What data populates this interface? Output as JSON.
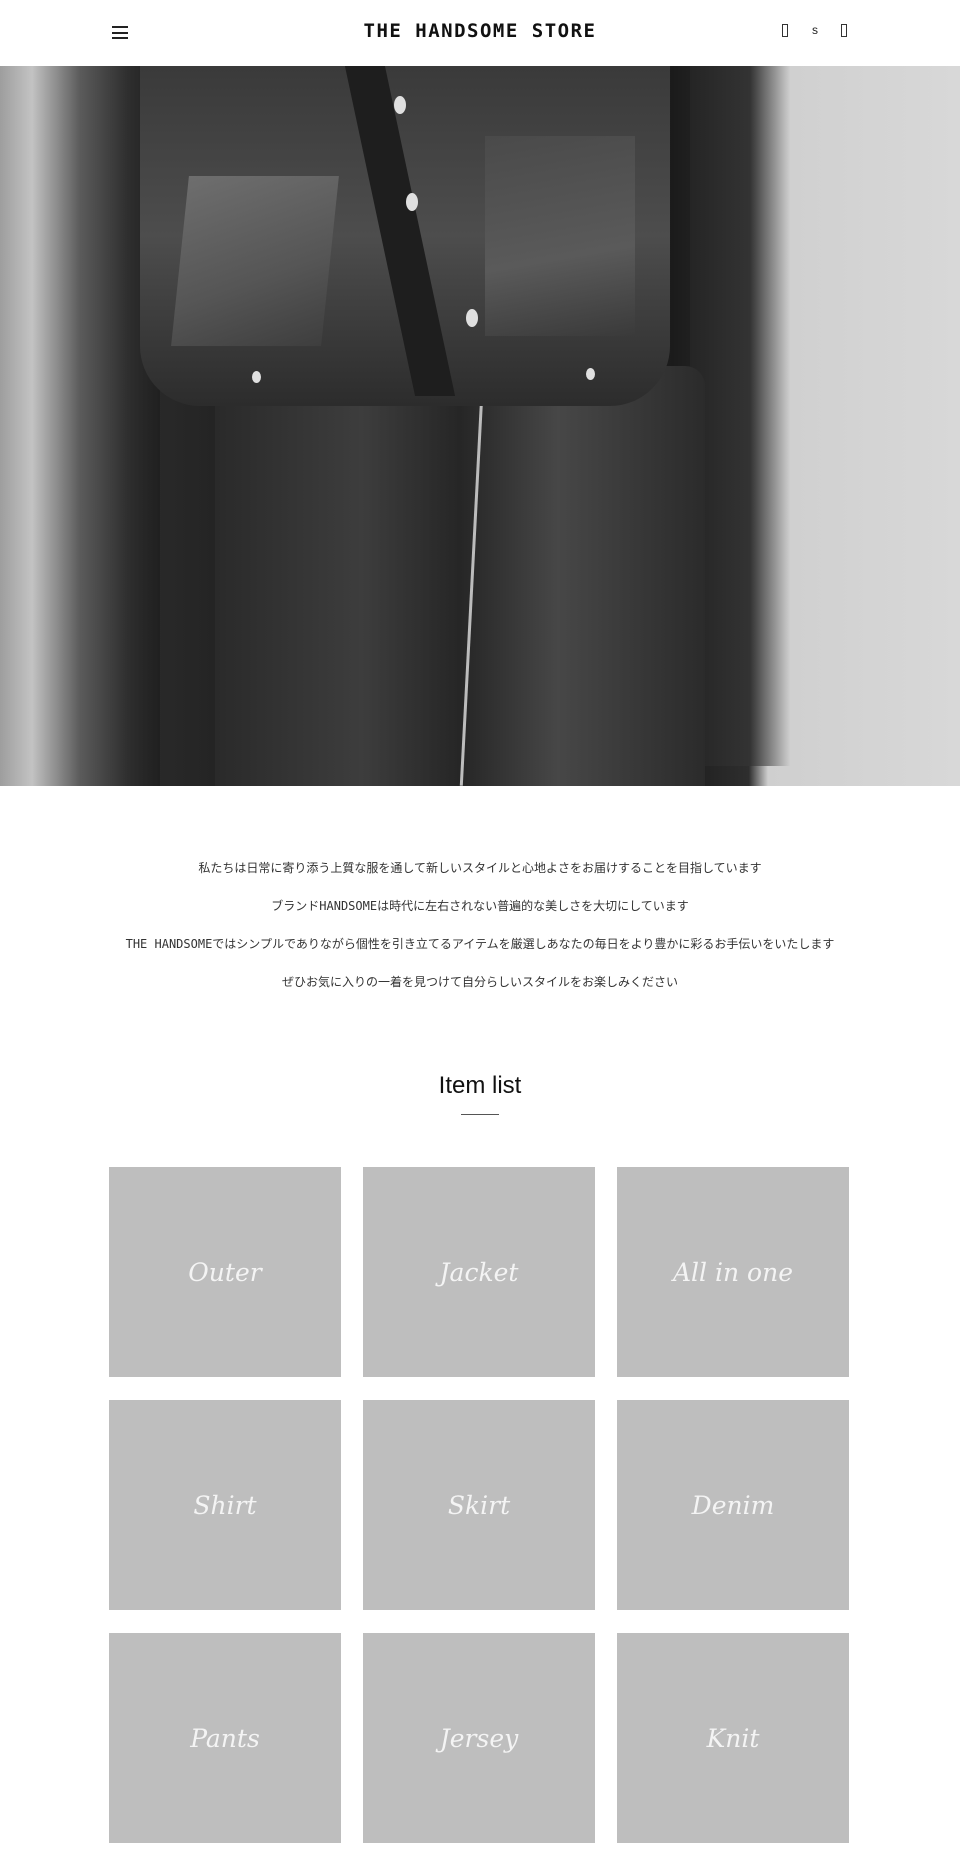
{
  "header": {
    "menu_icon": "hamburger-icon",
    "title": "THE HANDSOME STORE",
    "icons": [
      {
        "name": "search-icon",
        "glyph": "▯"
      },
      {
        "name": "account-icon",
        "glyph": "s"
      },
      {
        "name": "cart-icon",
        "glyph": "▯"
      }
    ]
  },
  "hero": {
    "alt": "Model wearing dark denim shirt and jeans, black and white photo"
  },
  "intro": {
    "lines": [
      "私たちは日常に寄り添う上質な服を通して新しいスタイルと心地よさをお届けすることを目指しています",
      "ブランドHANDSOMEは時代に左右されない普遍的な美しさを大切にしています",
      "THE HANDSOMEではシンプルでありながら個性を引き立てるアイテムを厳選しあなたの毎日をより豊かに彩るお手伝いをいたします",
      "ぜひお気に入りの一着を見つけて自分らしいスタイルをお楽しみください"
    ]
  },
  "item_list": {
    "title": "Item list",
    "categories": [
      "Outer",
      "Jacket",
      "All in one",
      "Shirt",
      "Skirt",
      "Denim",
      "Pants",
      "Jersey",
      "Knit"
    ]
  },
  "colors": {
    "tile_bg": "#bebebe",
    "tile_text": "#f4f4f4",
    "text": "#111111"
  }
}
